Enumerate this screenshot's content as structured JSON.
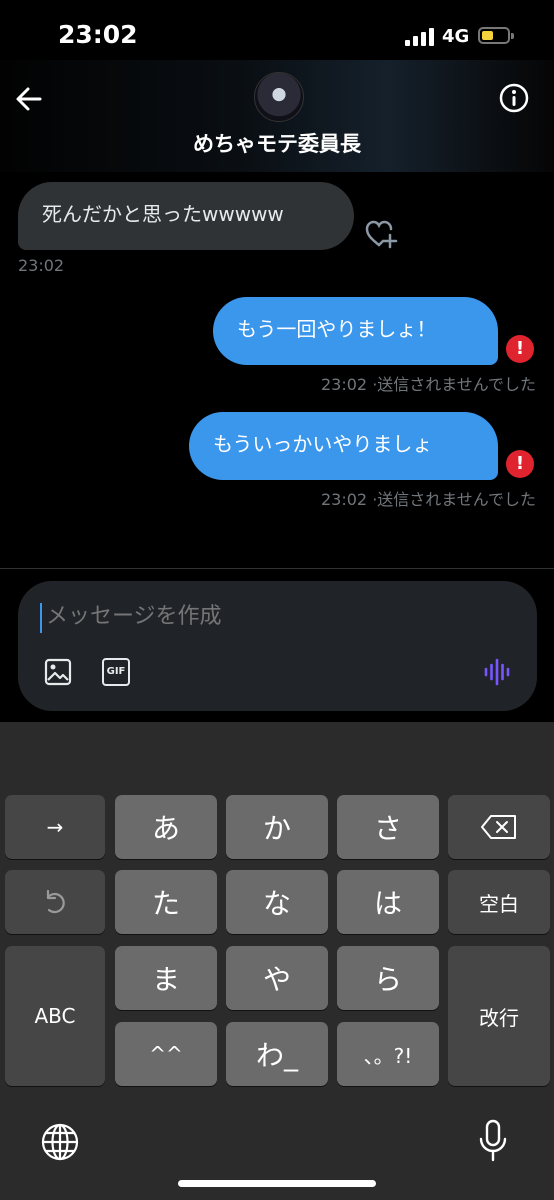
{
  "status_bar": {
    "time": "23:02",
    "network": "4G"
  },
  "header": {
    "contact_name": "めちゃモテ委員長"
  },
  "messages": [
    {
      "text": "死んだかと思ったwwwww",
      "time": "23:02"
    },
    {
      "text": "もう一回やりましょ！",
      "time": "23:02",
      "status": "·送信されませんでした",
      "error_glyph": "!"
    },
    {
      "text": "もういっかいやりましょ",
      "time": "23:02",
      "status": "·送信されませんでした",
      "error_glyph": "!"
    }
  ],
  "composer": {
    "placeholder": "メッセージを作成",
    "gif_label": "GIF"
  },
  "keyboard": {
    "row1": [
      "→",
      "あ",
      "か",
      "さ"
    ],
    "row2": [
      "た",
      "な",
      "は",
      "空白"
    ],
    "row3": [
      "ABC",
      "ま",
      "や",
      "ら",
      "改行"
    ],
    "row4": [
      "^^",
      "わ_",
      "、。?!"
    ]
  },
  "colors": {
    "accent": "#3b97ec",
    "error": "#e0242f",
    "voice": "#7856ff",
    "incoming": "#2f3336"
  }
}
